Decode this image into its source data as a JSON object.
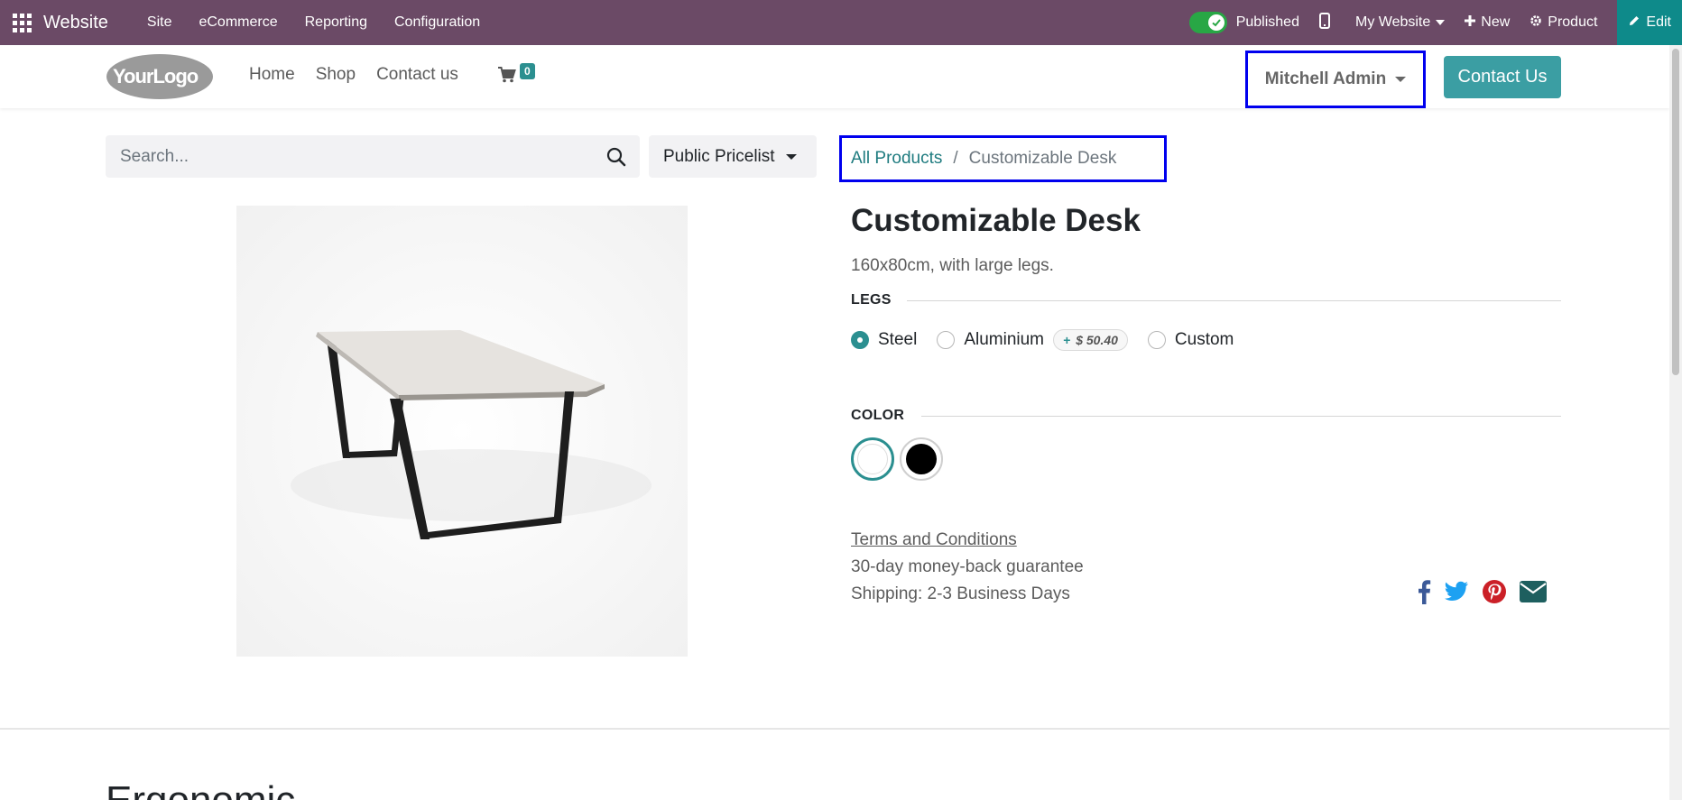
{
  "admin_bar": {
    "brand": "Website",
    "menu": [
      "Site",
      "eCommerce",
      "Reporting",
      "Configuration"
    ],
    "published_label": "Published",
    "website_label": "My Website",
    "new_label": "New",
    "product_label": "Product",
    "edit_label": "Edit"
  },
  "header": {
    "logo_text": "YourLogo",
    "nav": [
      "Home",
      "Shop",
      "Contact us"
    ],
    "cart_count": "0",
    "user_name": "Mitchell Admin",
    "contact_button": "Contact Us"
  },
  "toolbar": {
    "search_placeholder": "Search...",
    "pricelist": "Public Pricelist"
  },
  "breadcrumb": {
    "parent": "All Products",
    "separator": "/",
    "current": "Customizable Desk"
  },
  "product": {
    "title": "Customizable Desk",
    "description": "160x80cm, with large legs.",
    "legs_label": "LEGS",
    "legs_options": [
      {
        "label": "Steel",
        "checked": true
      },
      {
        "label": "Aluminium",
        "checked": false,
        "price_extra": "$ 50.40"
      },
      {
        "label": "Custom",
        "checked": false
      }
    ],
    "price_extra_plus": "+",
    "color_label": "COLOR",
    "colors": [
      {
        "name": "White",
        "hex": "#ffffff",
        "selected": true
      },
      {
        "name": "Black",
        "hex": "#000000",
        "selected": false
      }
    ],
    "terms": "Terms and Conditions",
    "guarantee": "30-day money-back guarantee",
    "shipping": "Shipping: 2-3 Business Days"
  },
  "share_icons": [
    "facebook-icon",
    "twitter-icon",
    "pinterest-icon",
    "email-icon"
  ],
  "section": {
    "title": "Ergonomic"
  },
  "colors": {
    "admin_bar": "#6b4a66",
    "accent": "#2b8f90",
    "edit": "#0e8a8a",
    "highlight_border": "#0000ee"
  }
}
